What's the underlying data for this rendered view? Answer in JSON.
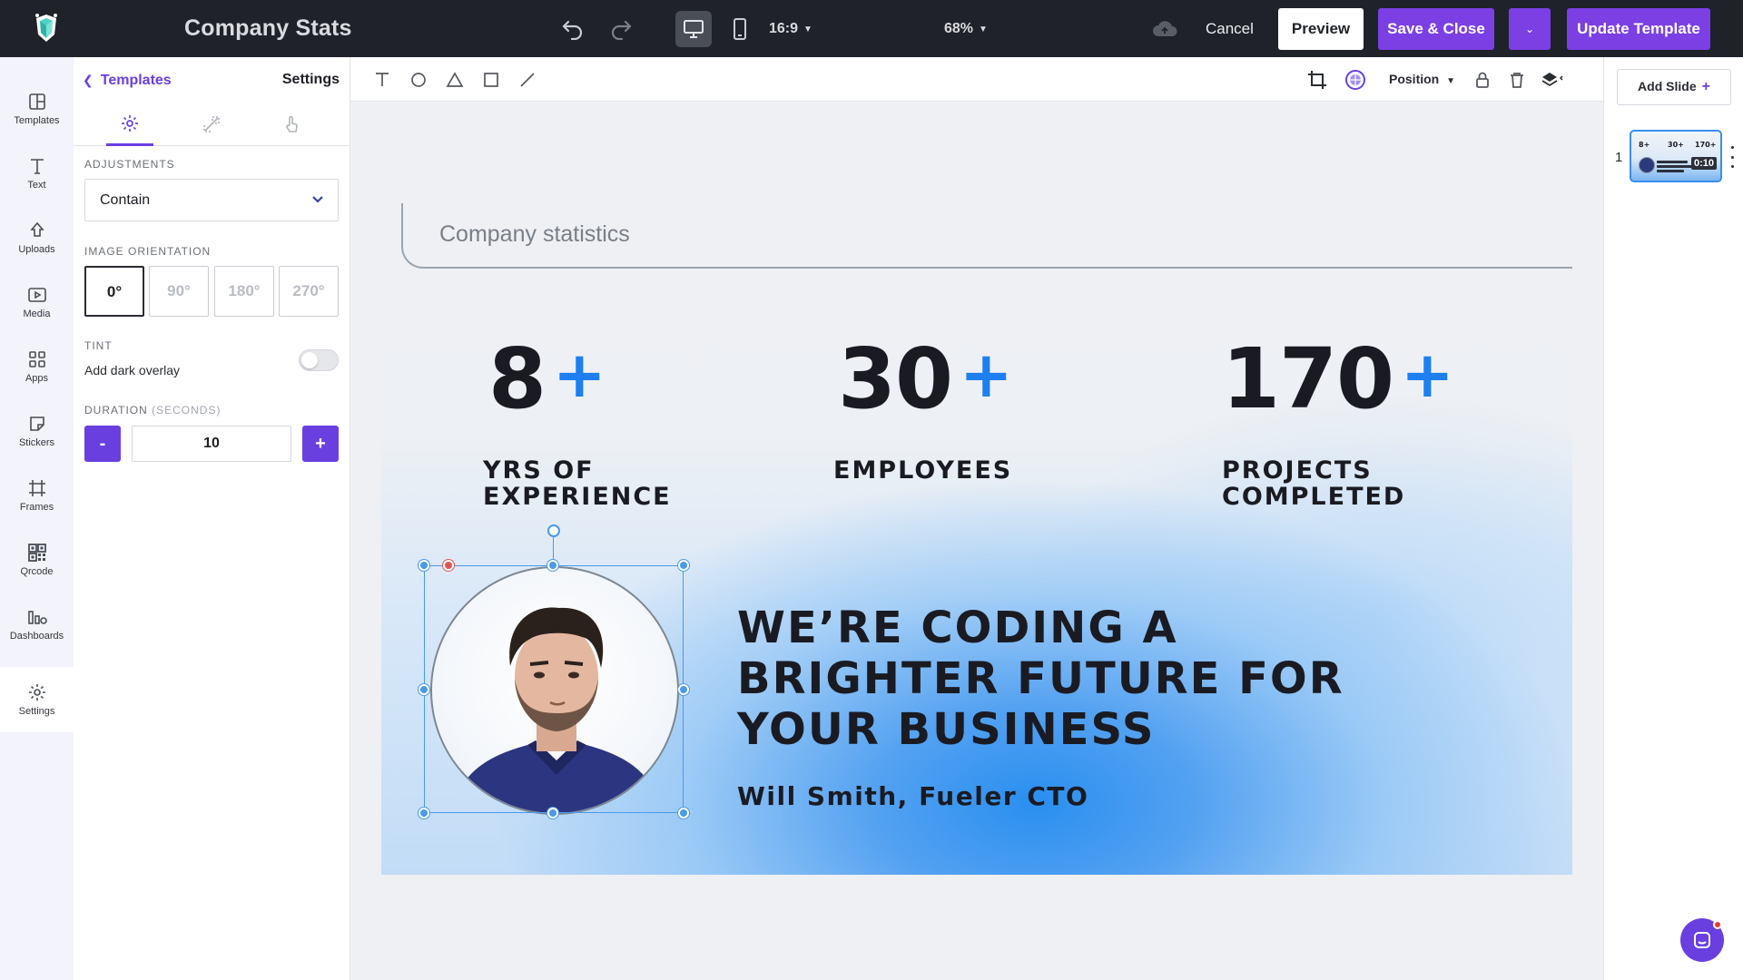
{
  "app": {
    "title": "Company Stats"
  },
  "topbar": {
    "ratio": "16:9",
    "zoom": "68%",
    "cancel_label": "Cancel",
    "preview_label": "Preview",
    "save_label": "Save & Close",
    "more_label": "⌄",
    "update_label": "Update Template"
  },
  "rail": {
    "items": [
      {
        "label": "Templates",
        "icon": "layout-icon"
      },
      {
        "label": "Text",
        "icon": "text-icon"
      },
      {
        "label": "Uploads",
        "icon": "upload-icon"
      },
      {
        "label": "Media",
        "icon": "media-icon"
      },
      {
        "label": "Apps",
        "icon": "apps-icon"
      },
      {
        "label": "Stickers",
        "icon": "sticker-icon"
      },
      {
        "label": "Frames",
        "icon": "frame-icon"
      },
      {
        "label": "Qrcode",
        "icon": "qrcode-icon"
      },
      {
        "label": "Dashboards",
        "icon": "dashboard-icon"
      },
      {
        "label": "Settings",
        "icon": "gear-icon"
      }
    ],
    "active": "Settings"
  },
  "panel": {
    "back_label": "Templates",
    "title": "Settings",
    "adjustments_label": "ADJUSTMENTS",
    "adjustment_value": "Contain",
    "orientation_label": "IMAGE ORIENTATION",
    "orientations": [
      "0°",
      "90°",
      "180°",
      "270°"
    ],
    "orientation_selected": "0°",
    "tint_label": "TINT",
    "tint_option": "Add dark overlay",
    "tint_enabled": false,
    "duration_label": "DURATION",
    "duration_unit": "(SECONDS)",
    "duration_value": "10",
    "minus_label": "-",
    "plus_label": "+"
  },
  "toolbar": {
    "position_label": "Position"
  },
  "slide": {
    "heading": "Company statistics",
    "stats": [
      {
        "value": "8",
        "suffix": "+",
        "label": "YRS OF\nEXPERIENCE"
      },
      {
        "value": "30",
        "suffix": "+",
        "label": "EMPLOYEES"
      },
      {
        "value": "170",
        "suffix": "+",
        "label": "PROJECTS\nCOMPLETED"
      }
    ],
    "headline": "WE’RE CODING A\nBRIGHTER FUTURE FOR\nYOUR BUSINESS",
    "byline": "Will Smith, Fueler CTO"
  },
  "slides_panel": {
    "add_label": "Add Slide",
    "add_icon": "+",
    "slides": [
      {
        "number": "1",
        "duration": "0:10",
        "thumb_stats": [
          "8+",
          "30+",
          "170+"
        ]
      }
    ]
  },
  "colors": {
    "accent": "#7b3fe4",
    "stat_plus": "#1e7ff0",
    "topbar_bg": "#1f2228"
  }
}
